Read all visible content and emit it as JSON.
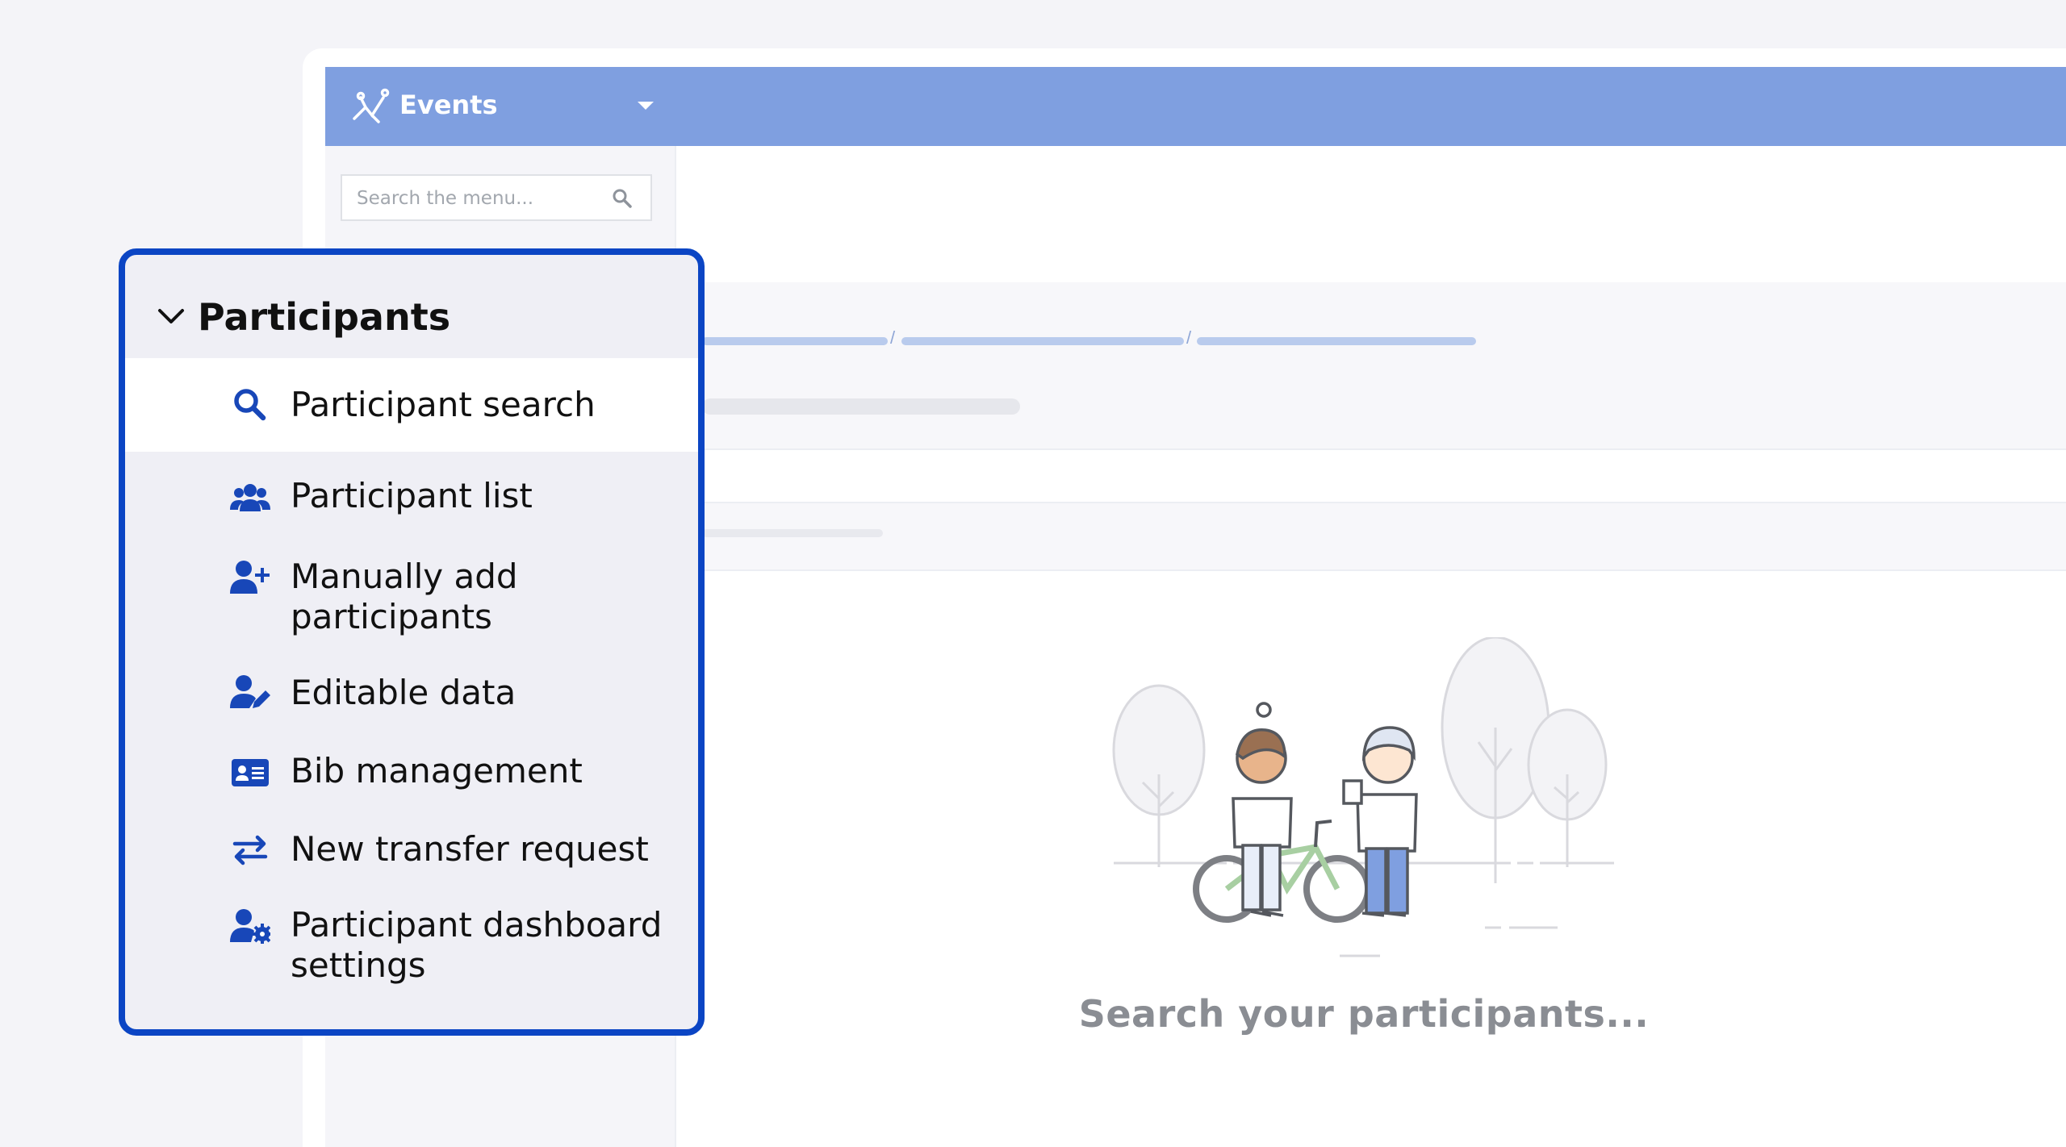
{
  "topbar": {
    "title": "Events"
  },
  "sidebar": {
    "search_placeholder": "Search the menu..."
  },
  "breadcrumb_separators": [
    "/",
    "/"
  ],
  "callout": {
    "group_label": "Participants",
    "items": [
      {
        "label": "Participant search",
        "icon": "search-icon",
        "active": true
      },
      {
        "label": "Participant list",
        "icon": "users-icon"
      },
      {
        "label": "Manually add participants",
        "line1": "Manually add",
        "line2": "participants",
        "icon": "user-plus-icon"
      },
      {
        "label": "Editable data",
        "icon": "user-edit-icon"
      },
      {
        "label": "Bib management",
        "icon": "id-card-icon"
      },
      {
        "label": "New transfer request",
        "icon": "transfer-arrows-icon"
      },
      {
        "label": "Participant dashboard settings",
        "line1": "Participant dashboard",
        "line2": "settings",
        "icon": "user-gear-icon"
      }
    ]
  },
  "main": {
    "empty_state_text": "Search your participants..."
  },
  "colors": {
    "accent": "#0b45c4",
    "topbar": "#7f9fe0",
    "icon": "#1847b8"
  }
}
